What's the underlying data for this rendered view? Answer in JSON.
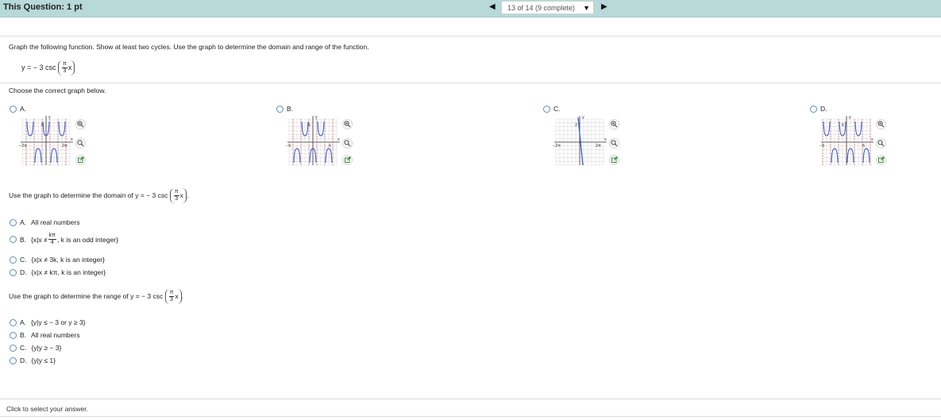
{
  "header": {
    "question_points": "This Question: 1 pt",
    "progress": "13 of 14 (9 complete)"
  },
  "question": {
    "prompt": "Graph the following function. Show at least two cycles. Use the graph to determine the domain and range of the function.",
    "func_lhs": "y = − 3 csc",
    "func_arg_num": "π",
    "func_arg_den": "3",
    "func_arg_var": "x"
  },
  "graph_section": {
    "instruction": "Choose the correct graph below.",
    "options": [
      {
        "label": "A.",
        "y_tick": "6",
        "x_neg": "−2π",
        "x_pos": "2π"
      },
      {
        "label": "B.",
        "y_tick": "6",
        "x_neg": "−6",
        "x_pos": "6"
      },
      {
        "label": "C.",
        "y_tick": "2",
        "x_neg": "−2π",
        "x_pos": "2π"
      },
      {
        "label": "D.",
        "y_tick": "6",
        "x_neg": "−6",
        "x_pos": "6"
      }
    ],
    "axis_y": "y",
    "axis_x": "x"
  },
  "domain_section": {
    "prompt": "Use the graph to determine the domain of y = − 3 csc",
    "options": [
      {
        "label": "A.",
        "text": "All real numbers"
      },
      {
        "label": "B.",
        "text_pre": "{x|x ≠",
        "frac_num": "kπ",
        "frac_den": "4",
        "text_post": ", k is an odd integer}"
      },
      {
        "label": "C.",
        "text": "{x|x ≠ 3k, k is an integer}"
      },
      {
        "label": "D.",
        "text": "{x|x ≠ kπ, k is an integer}"
      }
    ]
  },
  "range_section": {
    "prompt": "Use the graph to determine the range of y = − 3 csc",
    "options": [
      {
        "label": "A.",
        "text": "{y|y ≤ − 3 or y ≥ 3}"
      },
      {
        "label": "B.",
        "text": "All real numbers"
      },
      {
        "label": "C.",
        "text": "{y|y ≥ − 3}"
      },
      {
        "label": "D.",
        "text": "{y|y ≤ 1}"
      }
    ]
  },
  "footer": {
    "hint": "Click to select your answer."
  },
  "colors": {
    "header_bg": "#b7d9d7",
    "curve": "#3a5fcd",
    "radio": "#5b8fc4",
    "asymptote": "#d04040"
  }
}
